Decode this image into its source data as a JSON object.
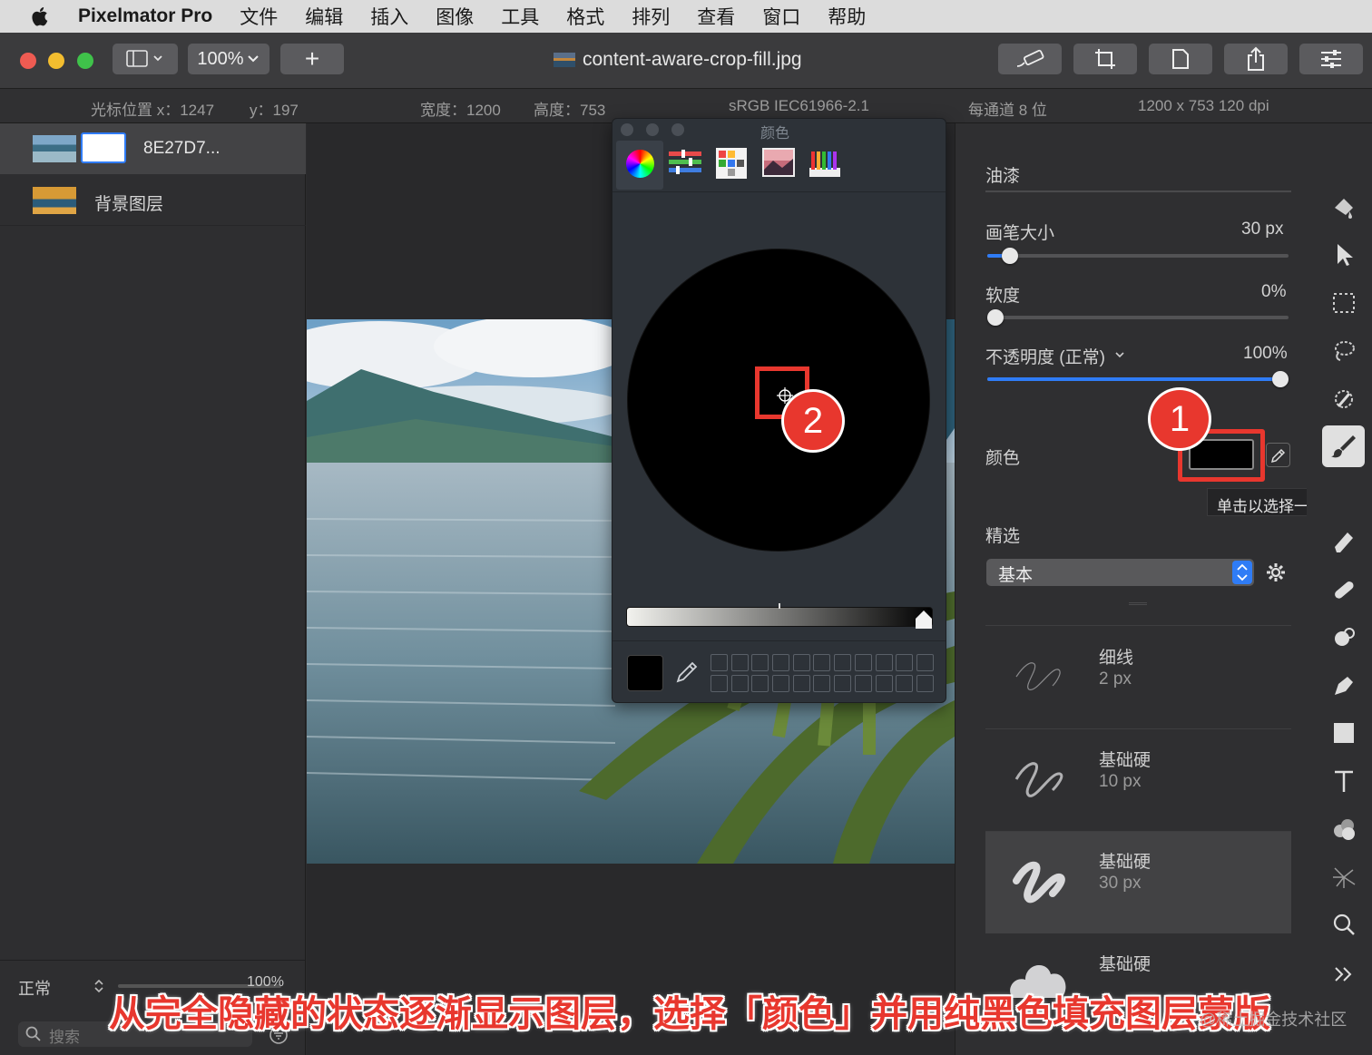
{
  "menubar": {
    "app_name": "Pixelmator Pro",
    "items": [
      "文件",
      "编辑",
      "插入",
      "图像",
      "工具",
      "格式",
      "排列",
      "查看",
      "窗口",
      "帮助"
    ]
  },
  "toolbar": {
    "zoom": "100%",
    "add": "+",
    "document_title": "content-aware-crop-fill.jpg"
  },
  "infobar": {
    "cursor_x": "光标位置 x：1247",
    "cursor_y": "y：197",
    "width": "宽度：1200",
    "height": "高度：753",
    "colorspace": "sRGB IEC61966-2.1",
    "depth": "每通道 8 位",
    "dimensions": "1200 x 753 120 dpi"
  },
  "layers": {
    "items": [
      {
        "name": "8E27D7..."
      },
      {
        "name": "背景图层"
      }
    ],
    "blend_mode": "正常",
    "opacity": "100%",
    "search_placeholder": "搜索"
  },
  "color_panel": {
    "title": "颜色"
  },
  "inspector": {
    "section_title": "油漆",
    "brush_size_label": "画笔大小",
    "brush_size_value": "30 px",
    "brush_size_fraction": 0.05,
    "softness_label": "软度",
    "softness_value": "0%",
    "softness_fraction": 0,
    "opacity_label": "不透明度 (正常)",
    "opacity_value": "100%",
    "opacity_fraction": 1,
    "color_label": "颜色",
    "color_value": "#000000",
    "tooltip": "单击以选择一种颜色。",
    "presets_label": "精选",
    "presets_select": "基本",
    "presets": [
      {
        "name": "细线",
        "size": "2 px"
      },
      {
        "name": "基础硬",
        "size": "10 px"
      },
      {
        "name": "基础硬",
        "size": "30 px"
      },
      {
        "name": "基础硬",
        "size": ""
      }
    ]
  },
  "annotations": {
    "marker1": "1",
    "marker2": "2",
    "caption": "从完全隐藏的状态逐渐显示图层，选择「颜色」并用纯黑色填充图层蒙版",
    "watermark": "@稀土掘金技术社区"
  },
  "colors": {
    "accent_blue": "#2f7cf6",
    "annotation_red": "#e8372e"
  }
}
